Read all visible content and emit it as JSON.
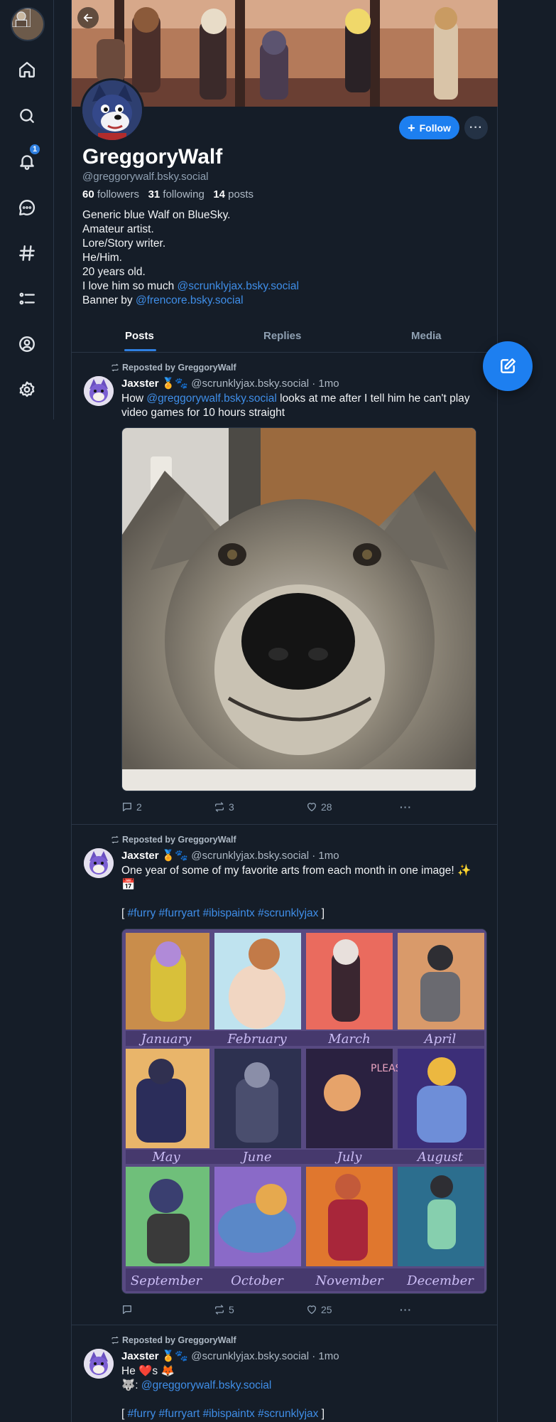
{
  "profile": {
    "display_name": "GreggoryWalf",
    "handle": "@greggorywalf.bsky.social",
    "followers_count": "60",
    "followers_label": "followers",
    "following_count": "31",
    "following_label": "following",
    "posts_count": "14",
    "posts_label": "posts",
    "follow_label": "Follow",
    "bio": {
      "line1": "Generic blue Walf on BlueSky.",
      "line2": "Amateur artist.",
      "line3": "Lore/Story writer.",
      "line4": "He/Him.",
      "line5": "20 years old.",
      "line6_text": "I love him so much ",
      "line6_link": "@scrunklyjax.bsky.social",
      "line7_text": "Banner by ",
      "line7_link": "@frencore.bsky.social"
    }
  },
  "nav": {
    "notifications_badge": "1",
    "icons": [
      "home-icon",
      "search-icon",
      "bell-icon",
      "chat-icon",
      "hash-icon",
      "list-icon",
      "profile-icon",
      "settings-icon"
    ]
  },
  "tabs": [
    "Posts",
    "Replies",
    "Media"
  ],
  "posts": [
    {
      "repost_label": "Reposted by GreggoryWalf",
      "author": "Jaxster",
      "author_emoji": "🏅🐾",
      "handle_time": "@scrunklyjax.bsky.social · 1mo",
      "text_before": "How ",
      "text_link": "@greggorywalf.bsky.social",
      "text_after": " looks at me after I tell him he can't play video games for 10 hours straight",
      "replies": "2",
      "reposts": "3",
      "likes": "28"
    },
    {
      "repost_label": "Reposted by GreggoryWalf",
      "author": "Jaxster",
      "author_emoji": "🏅🐾",
      "handle_time": "@scrunklyjax.bsky.social · 1mo",
      "text": "One year of some of my favorite arts from each month in one image! ✨📅",
      "tags_open": "[ ",
      "tags": "#furry #furryart #ibispaintx #scrunklyjax",
      "tags_close": " ]",
      "months": [
        "January",
        "February",
        "March",
        "April",
        "May",
        "June",
        "July",
        "August",
        "September",
        "October",
        "November",
        "December"
      ],
      "replies": "",
      "reposts": "5",
      "likes": "25"
    },
    {
      "repost_label": "Reposted by GreggoryWalf",
      "author": "Jaxster",
      "author_emoji": "🏅🐾",
      "handle_time": "@scrunklyjax.bsky.social · 1mo",
      "line1": "He ❤️s 🦊",
      "line2_prefix": "🐺: ",
      "line2_link": "@greggorywalf.bsky.social",
      "tags_open": "[ ",
      "tags": "#furry #furryart #ibispaintx #scrunklyjax",
      "tags_close": " ]"
    }
  ],
  "colors": {
    "background": "#151d28",
    "accent": "#1d7ff0",
    "link": "#3f8ee8",
    "month_grid": "#584a82"
  }
}
